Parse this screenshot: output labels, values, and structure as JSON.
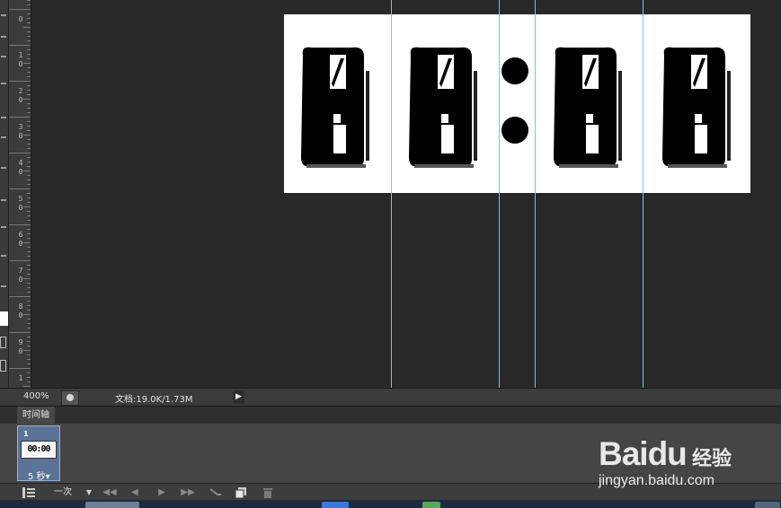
{
  "ruler": {
    "labels": [
      "0",
      "1\n0",
      "2\n0",
      "3\n0",
      "4\n0",
      "5\n0",
      "6\n0",
      "7\n0",
      "8\n0",
      "9\n0",
      "1"
    ]
  },
  "canvas": {
    "digits": [
      "0",
      "0",
      "0",
      "0"
    ],
    "separator": ":"
  },
  "status": {
    "zoom": "400%",
    "doc_size": "文档:19.0K/1.73M",
    "arrow": "▶"
  },
  "timeline": {
    "tab_label": "时间轴",
    "frame": {
      "number": "1",
      "preview_text": "00:00",
      "delay": "5 秒▾"
    },
    "controls": {
      "loop": "一次",
      "loop_arrow": "▼",
      "first_frame": "◀◀",
      "prev_frame": "◀",
      "play": "▶",
      "next_frame": "▶▶"
    }
  },
  "watermark": {
    "logo": "Baidu",
    "cn": "经验",
    "url": "jingyan.baidu.com"
  },
  "colors": {
    "guide": "#5fd0e6",
    "frame_selected": "#5a7396",
    "canvas_bg": "#282828"
  },
  "icons": [
    "frame-options-icon",
    "tween-icon",
    "duplicate-frame-icon",
    "delete-frame-icon",
    "zoom-info-icon"
  ]
}
